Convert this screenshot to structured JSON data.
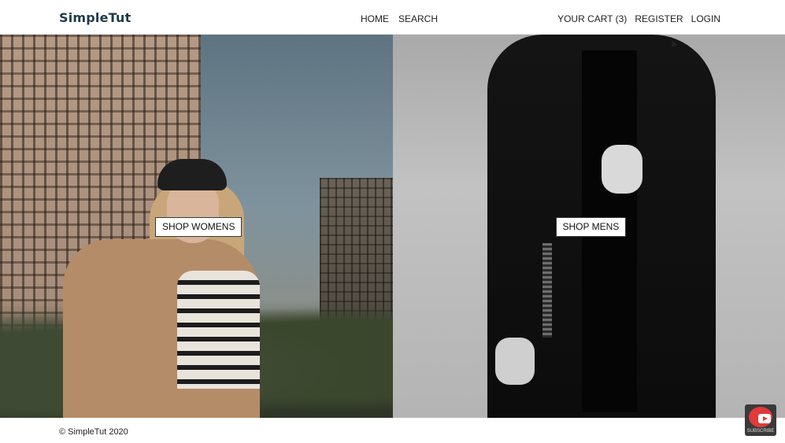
{
  "header": {
    "logo": "SimpleTut",
    "nav_center": [
      "HOME",
      "SEARCH"
    ],
    "nav_right": [
      "YOUR CART (3)",
      "REGISTER",
      "LOGIN"
    ]
  },
  "hero": {
    "womens_button": "SHOP WOMENS",
    "mens_button": "SHOP MENS"
  },
  "footer": {
    "copyright": "© SimpleTut 2020"
  },
  "overlay": {
    "youtube_label": "SUBSCRIBE",
    "youtube_icon": "youtube-icon"
  },
  "colors": {
    "logo": "#1f3b4a",
    "button_bg": "#ffffff",
    "button_border": "#3a3a3a",
    "youtube_red": "#e03a3a"
  }
}
